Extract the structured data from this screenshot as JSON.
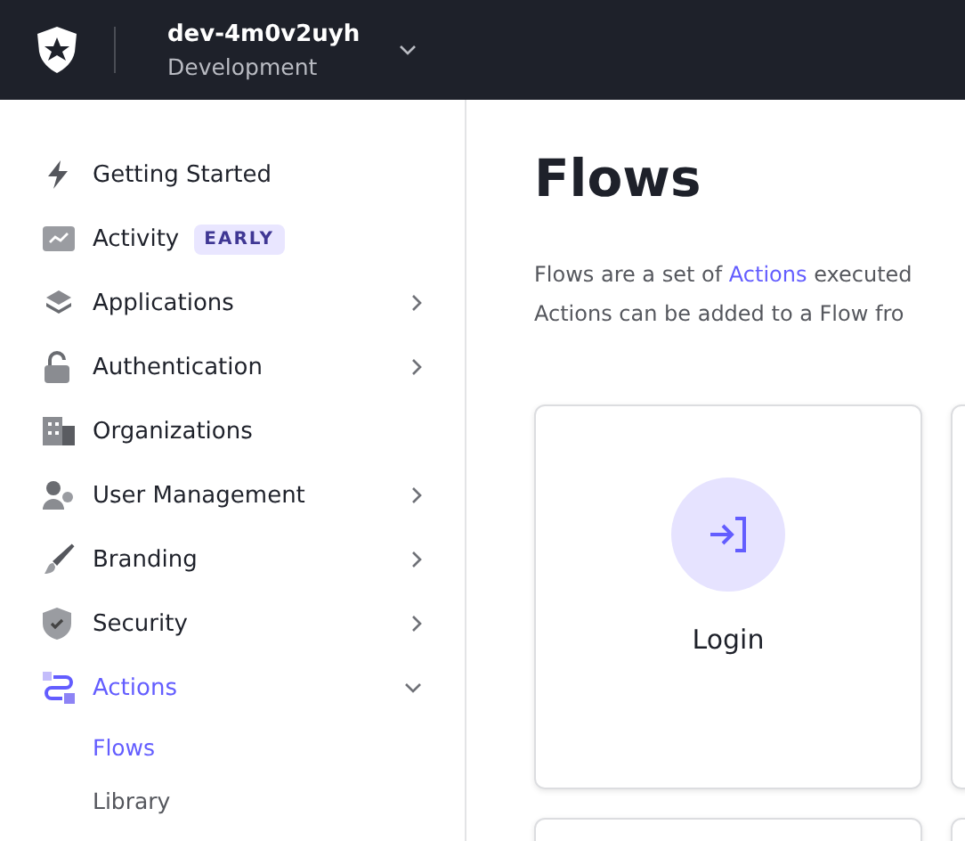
{
  "header": {
    "tenant": "dev-4m0v2uyh",
    "environment": "Development"
  },
  "sidebar": {
    "items": [
      {
        "label": "Getting Started",
        "selected": false
      },
      {
        "label": "Activity",
        "badge": "EARLY",
        "selected": false
      },
      {
        "label": "Applications",
        "expanded": false,
        "selected": false
      },
      {
        "label": "Authentication",
        "expanded": false,
        "selected": false
      },
      {
        "label": "Organizations",
        "selected": false
      },
      {
        "label": "User Management",
        "expanded": false,
        "selected": false
      },
      {
        "label": "Branding",
        "expanded": false,
        "selected": false
      },
      {
        "label": "Security",
        "expanded": false,
        "selected": false
      },
      {
        "label": "Actions",
        "expanded": true,
        "selected": true,
        "children": [
          {
            "label": "Flows",
            "selected": true
          },
          {
            "label": "Library",
            "selected": false
          }
        ]
      }
    ]
  },
  "page": {
    "title": "Flows",
    "description": {
      "before": "Flows are a set of",
      "link": "Actions",
      "after": "executed",
      "line_2": "Actions can be added to a Flow fro"
    },
    "cards": [
      {
        "label": "Login"
      }
    ]
  }
}
